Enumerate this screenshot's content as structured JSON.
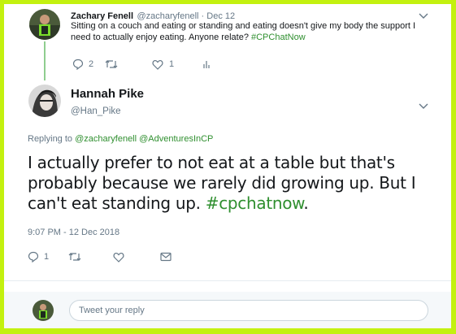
{
  "parent_tweet": {
    "name": "Zachary Fenell",
    "handle_date": "@zacharyfenell · Dec 12",
    "text": "Sitting on a couch and eating or standing and eating doesn't give my body the support I need to actually enjoy eating. Anyone relate? ",
    "hashtag": "#CPChatNow",
    "reply_count": "2",
    "retweet_count": "",
    "like_count": "1"
  },
  "main_tweet": {
    "name": "Hannah Pike",
    "handle": "@Han_Pike",
    "replying_to_label": "Replying to ",
    "replying_to_users": "@zacharyfenell @AdventuresInCP",
    "text": "I actually prefer to not eat at a table but that's probably because we rarely did growing up. But I can't eat standing up. ",
    "hashtag": "#cpchatnow",
    "text_end": ".",
    "timestamp": "9:07 PM - 12 Dec 2018",
    "reply_count": "1"
  },
  "reply_box": {
    "placeholder": "Tweet your reply"
  },
  "icons": [
    "reply-icon",
    "retweet-icon",
    "like-icon",
    "analytics-icon",
    "message-icon",
    "chevron-down-icon"
  ],
  "colors": {
    "frame": "#c3f10f",
    "hashtag": "#2f8f2f",
    "thread_line": "#8fce8f"
  }
}
